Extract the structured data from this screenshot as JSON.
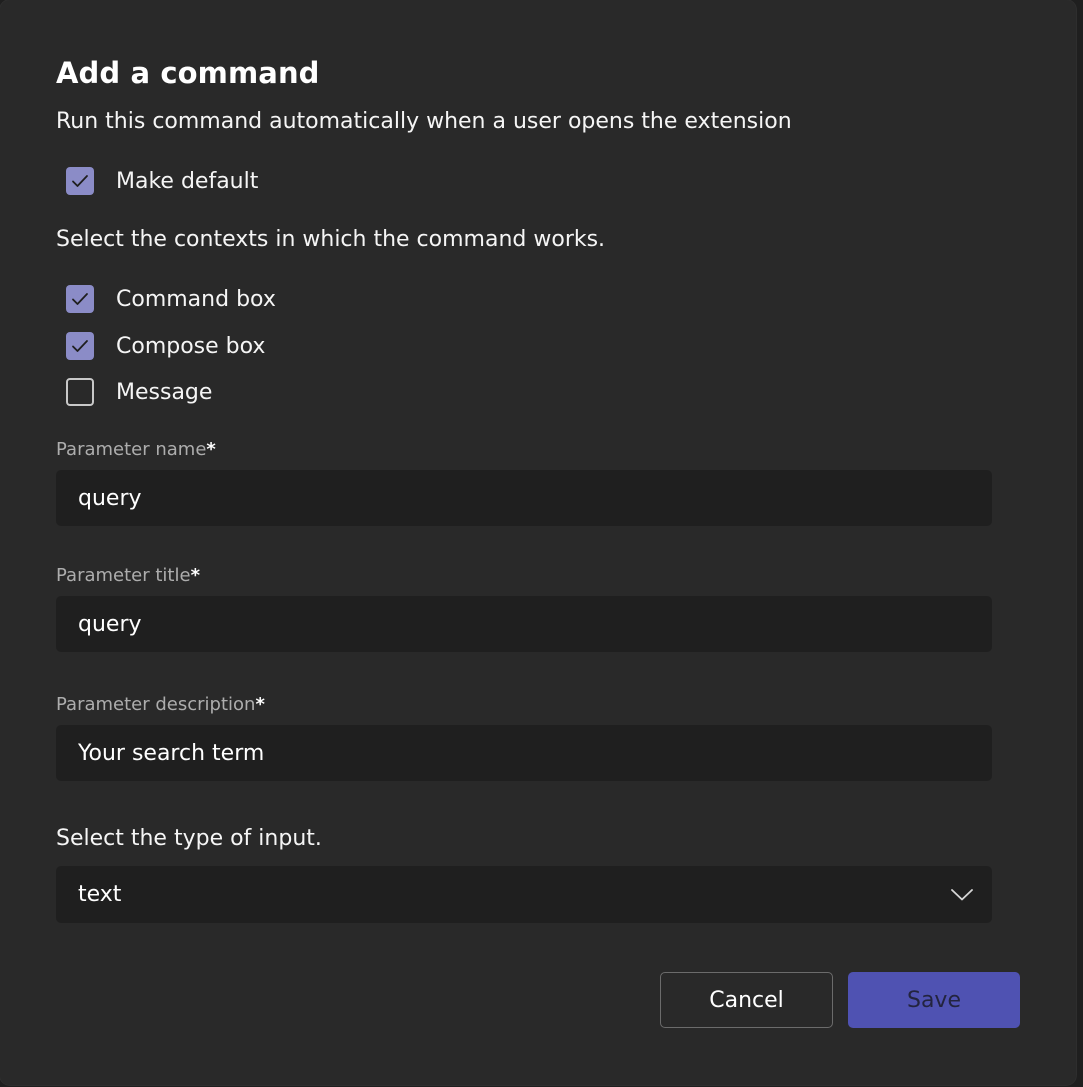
{
  "dialog": {
    "title": "Add a command",
    "subtitle": "Run this command automatically when a user opens the extension",
    "make_default": {
      "label": "Make default",
      "checked": true
    },
    "contexts_prompt": "Select the contexts in which the command works.",
    "contexts": [
      {
        "label": "Command box",
        "checked": true
      },
      {
        "label": "Compose box",
        "checked": true
      },
      {
        "label": "Message",
        "checked": false
      }
    ],
    "fields": {
      "parameter_name": {
        "label": "Parameter name",
        "required_mark": "*",
        "value": "query"
      },
      "parameter_title": {
        "label": "Parameter title",
        "required_mark": "*",
        "value": "query"
      },
      "parameter_description": {
        "label": "Parameter description",
        "required_mark": "*",
        "value": "Your search term"
      }
    },
    "input_type_prompt": "Select the type of input.",
    "input_type": {
      "value": "text",
      "icon": "chevron-down-icon"
    },
    "buttons": {
      "cancel": "Cancel",
      "save": "Save"
    },
    "colors": {
      "accent": "#8b8cc7",
      "save_button": "#4f52b2",
      "panel": "#292929",
      "field_bg": "#1f1f1f"
    }
  }
}
